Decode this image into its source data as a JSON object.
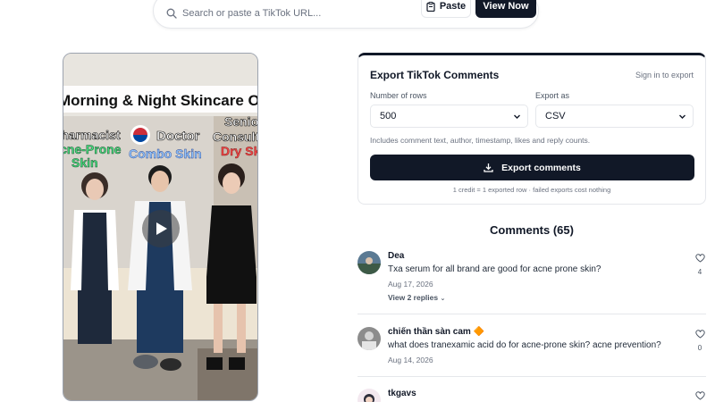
{
  "search": {
    "placeholder": "Search or paste a TikTok URL...",
    "paste_label": "Paste",
    "view_label": "View Now"
  },
  "video": {
    "overlay_title": "Morning & Night Skincare Order",
    "people": [
      {
        "role": "Pharmacist",
        "skin": "Acne-Prone Skin",
        "skin_color": "#4ade80"
      },
      {
        "role": "Doctor",
        "skin": "Combo Skin",
        "skin_color": "#93c5fd"
      },
      {
        "role": "Senior Consultant",
        "skin": "Dry Skin",
        "skin_color": "#ef4444"
      }
    ],
    "play_icon": "play-icon"
  },
  "export": {
    "title": "Export TikTok Comments",
    "signin_link": "Sign in to export",
    "rows_label": "Number of rows",
    "rows_value": "500",
    "format_label": "Export as",
    "format_value": "CSV",
    "hint": "Includes comment text, author, timestamp, likes and reply counts.",
    "button_label": "Export comments",
    "button_icon": "download-icon",
    "footnote": "1 credit = 1 exported row · failed exports cost nothing"
  },
  "comments": {
    "title": "Comments (65)",
    "items": [
      {
        "author": "Dea",
        "text": "Txa serum for all brand are good for acne prone skin?",
        "date": "Aug 17, 2026",
        "replies": "View 2 replies",
        "likes": "4"
      },
      {
        "author": "chiến thần sàn cam 🔶",
        "text": "what does tranexamic acid do for acne-prone skin? acne prevention?",
        "date": "Aug 14, 2026",
        "replies": "",
        "likes": "0"
      },
      {
        "author": "tkgavs",
        "text": "",
        "date": "",
        "replies": "",
        "likes": ""
      }
    ]
  },
  "colors": {
    "primary": "#111827",
    "border": "#e5e7eb",
    "muted": "#6b7280"
  }
}
